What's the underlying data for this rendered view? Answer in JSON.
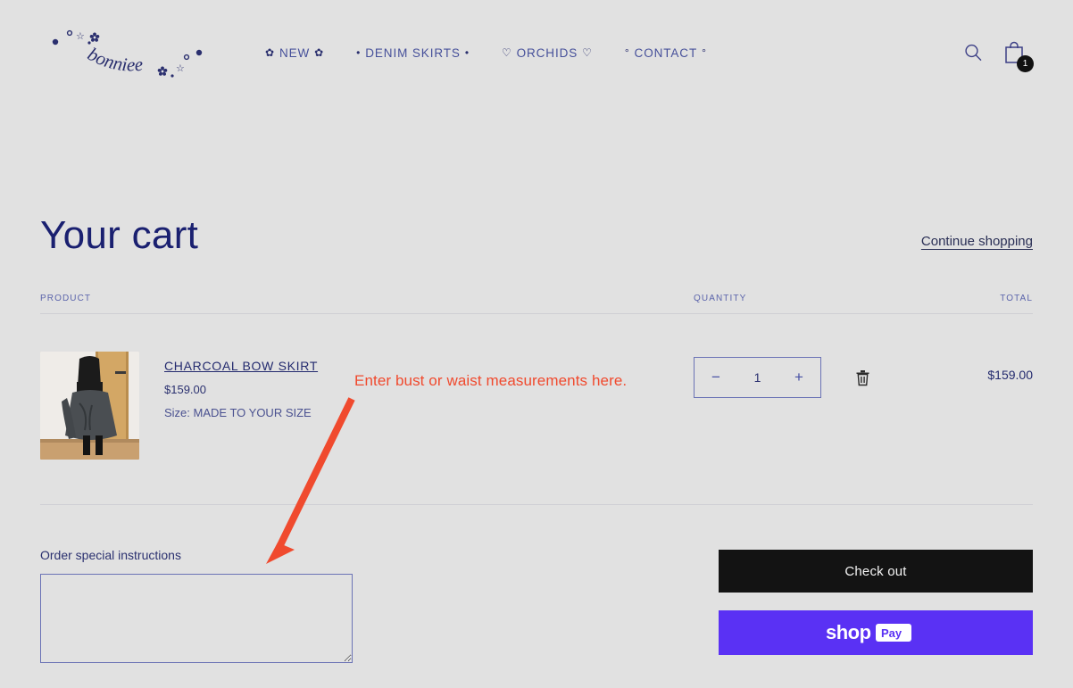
{
  "brand": {
    "logo_text": "bonniee",
    "logo_color": "#2a2f6e"
  },
  "header": {
    "nav": [
      {
        "label": "NEW",
        "prefix": "✿",
        "suffix": "✿",
        "name": "nav-new"
      },
      {
        "label": "DENIM SKIRTS",
        "prefix": "•",
        "suffix": "•",
        "name": "nav-denim-skirts"
      },
      {
        "label": "ORCHIDS",
        "prefix": "♡",
        "suffix": "♡",
        "name": "nav-orchids"
      },
      {
        "label": "CONTACT",
        "prefix": "°",
        "suffix": "°",
        "name": "nav-contact"
      }
    ],
    "search_icon": "search-icon",
    "cart_icon": "shopping-bag-icon",
    "cart_count": "1"
  },
  "cart": {
    "title": "Your cart",
    "continue_shopping": "Continue shopping",
    "columns": {
      "product": "PRODUCT",
      "quantity": "QUANTITY",
      "total": "TOTAL"
    },
    "items": [
      {
        "title": "CHARCOAL BOW SKIRT",
        "price": "$159.00",
        "variant": "Size: MADE TO YOUR SIZE",
        "quantity": "1",
        "total": "$159.00",
        "decrease_label": "−",
        "increase_label": "+",
        "remove_icon": "trash-icon"
      }
    ],
    "notes_label": "Order special instructions",
    "notes_value": "",
    "checkout_label": "Check out",
    "shop_pay_label": "shop Pay"
  },
  "annotation": {
    "text": "Enter bust or waist measurements here.",
    "color": "#f04a2e",
    "arrow": "arrow-pointing-to-instructions"
  },
  "colors": {
    "background": "#e1e1e1",
    "navy": "#2a2f6e",
    "shop_pay_purple": "#5a31f4",
    "checkout_black": "#131313"
  }
}
